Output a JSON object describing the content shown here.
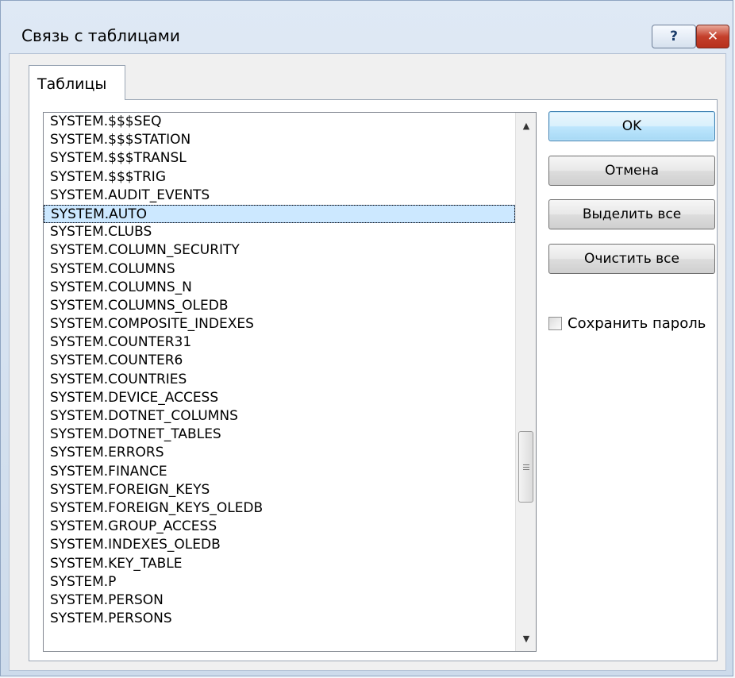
{
  "window": {
    "title": "Связь с таблицами",
    "help_glyph": "?",
    "close_glyph": "✕"
  },
  "tabs": [
    {
      "label": "Таблицы"
    }
  ],
  "tables": {
    "items": [
      "SYSTEM.$$$SEQ",
      "SYSTEM.$$$STATION",
      "SYSTEM.$$$TRANSL",
      "SYSTEM.$$$TRIG",
      "SYSTEM.AUDIT_EVENTS",
      "SYSTEM.AUTO",
      "SYSTEM.CLUBS",
      "SYSTEM.COLUMN_SECURITY",
      "SYSTEM.COLUMNS",
      "SYSTEM.COLUMNS_N",
      "SYSTEM.COLUMNS_OLEDB",
      "SYSTEM.COMPOSITE_INDEXES",
      "SYSTEM.COUNTER31",
      "SYSTEM.COUNTER6",
      "SYSTEM.COUNTRIES",
      "SYSTEM.DEVICE_ACCESS",
      "SYSTEM.DOTNET_COLUMNS",
      "SYSTEM.DOTNET_TABLES",
      "SYSTEM.ERRORS",
      "SYSTEM.FINANCE",
      "SYSTEM.FOREIGN_KEYS",
      "SYSTEM.FOREIGN_KEYS_OLEDB",
      "SYSTEM.GROUP_ACCESS",
      "SYSTEM.INDEXES_OLEDB",
      "SYSTEM.KEY_TABLE",
      "SYSTEM.P",
      "SYSTEM.PERSON",
      "SYSTEM.PERSONS"
    ],
    "selected": "SYSTEM.AUTO"
  },
  "scrollbar": {
    "up_arrow": "▲",
    "down_arrow": "▼"
  },
  "buttons": {
    "ok": "OK",
    "cancel": "Отмена",
    "select_all": "Выделить все",
    "clear_all": "Очистить все"
  },
  "save_password": {
    "label": "Сохранить пароль",
    "checked": false
  }
}
